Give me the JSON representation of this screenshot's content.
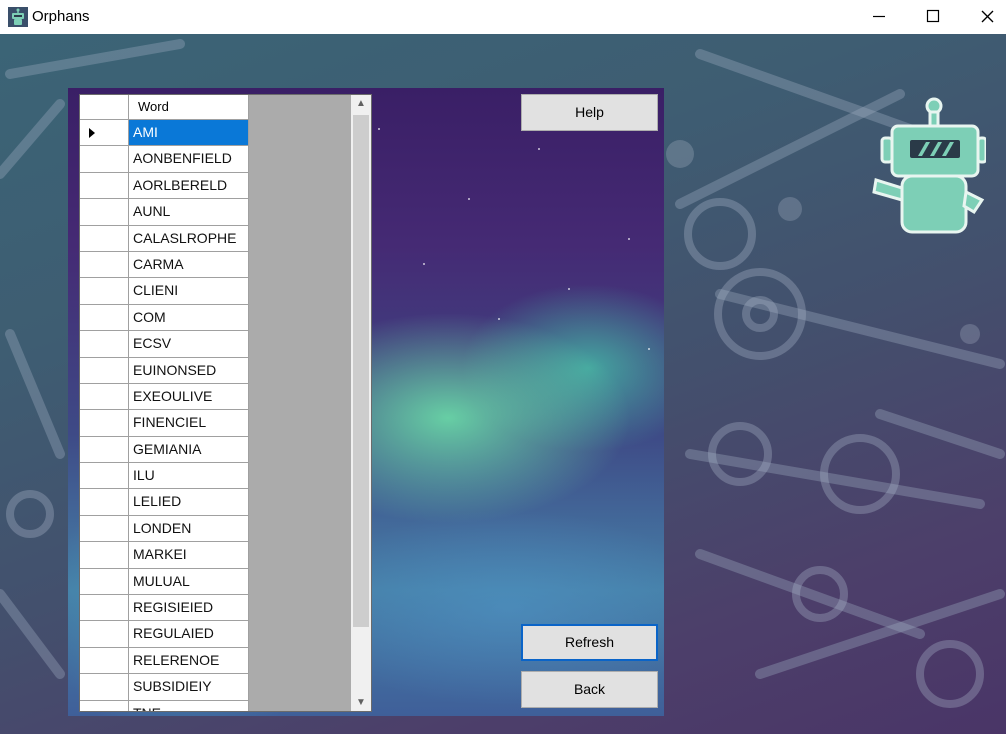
{
  "window": {
    "title": "Orphans",
    "minimize_glyph": "—",
    "maximize_glyph": "☐",
    "close_glyph": "✕",
    "app_icon": "robot-icon"
  },
  "grid": {
    "column_header": "Word",
    "rows": [
      "AMI",
      "AONBENFIELD",
      "AORLBERELD",
      "AUNL",
      "CALASLROPHE",
      "CARMA",
      "CLIENI",
      "COM",
      "ECSV",
      "EUINONSED",
      "EXEOULIVE",
      "FINENCIEL",
      "GEMIANIA",
      "ILU",
      "LELIED",
      "LONDEN",
      "MARKEI",
      "MULUAL",
      "REGISIEIED",
      "REGULAIED",
      "RELERENOE",
      "SUBSIDIEIY",
      "TNE"
    ],
    "selected_index": 0,
    "scroll_up_glyph": "▲",
    "scroll_down_glyph": "▼"
  },
  "buttons": {
    "help": "Help",
    "refresh": "Refresh",
    "back": "Back"
  },
  "colors": {
    "selection": "#0a78d7",
    "robot": "#7dcfb6",
    "focus_border": "#0a64c8"
  }
}
